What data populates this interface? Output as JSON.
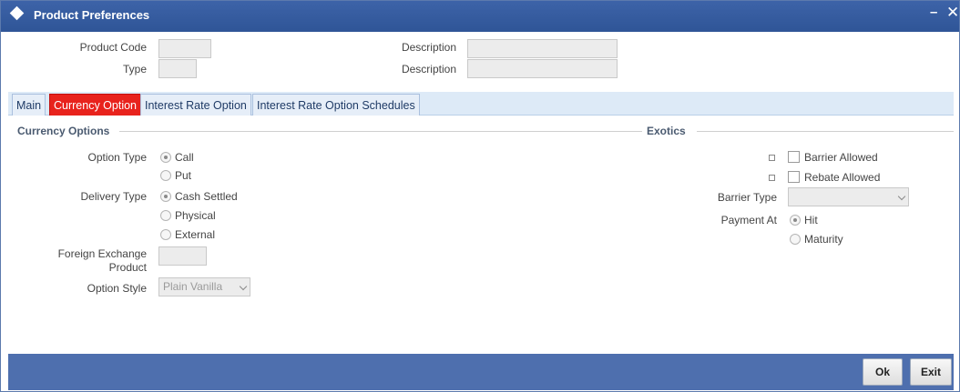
{
  "window": {
    "title": "Product Preferences"
  },
  "header": {
    "product_code_label": "Product Code",
    "type_label": "Type",
    "description_label_1": "Description",
    "description_label_2": "Description",
    "product_code_value": "",
    "type_value": "",
    "description_value_1": "",
    "description_value_2": ""
  },
  "tabs": [
    {
      "label": "Main",
      "active": false
    },
    {
      "label": "Currency Option",
      "active": true
    },
    {
      "label": "Interest Rate Option",
      "active": false
    },
    {
      "label": "Interest Rate Option Schedules",
      "active": false
    }
  ],
  "currency_options": {
    "legend": "Currency Options",
    "option_type_label": "Option Type",
    "option_type_options": [
      "Call",
      "Put"
    ],
    "option_type_selected": "Call",
    "delivery_type_label": "Delivery Type",
    "delivery_type_options": [
      "Cash Settled",
      "Physical",
      "External"
    ],
    "delivery_type_selected": "Cash Settled",
    "fx_product_label_line1": "Foreign Exchange",
    "fx_product_label_line2": "Product",
    "fx_product_value": "",
    "option_style_label": "Option Style",
    "option_style_value": "Plain Vanilla"
  },
  "exotics": {
    "legend": "Exotics",
    "barrier_allowed_label": "Barrier Allowed",
    "rebate_allowed_label": "Rebate Allowed",
    "barrier_type_label": "Barrier Type",
    "barrier_type_value": "",
    "payment_at_label": "Payment At",
    "payment_at_options": [
      "Hit",
      "Maturity"
    ],
    "payment_at_selected": "Hit"
  },
  "footer": {
    "ok_label": "Ok",
    "exit_label": "Exit"
  },
  "colors": {
    "titlebar": "#2f5597",
    "active_tab": "#e8231d",
    "footer": "#4e6fae"
  }
}
